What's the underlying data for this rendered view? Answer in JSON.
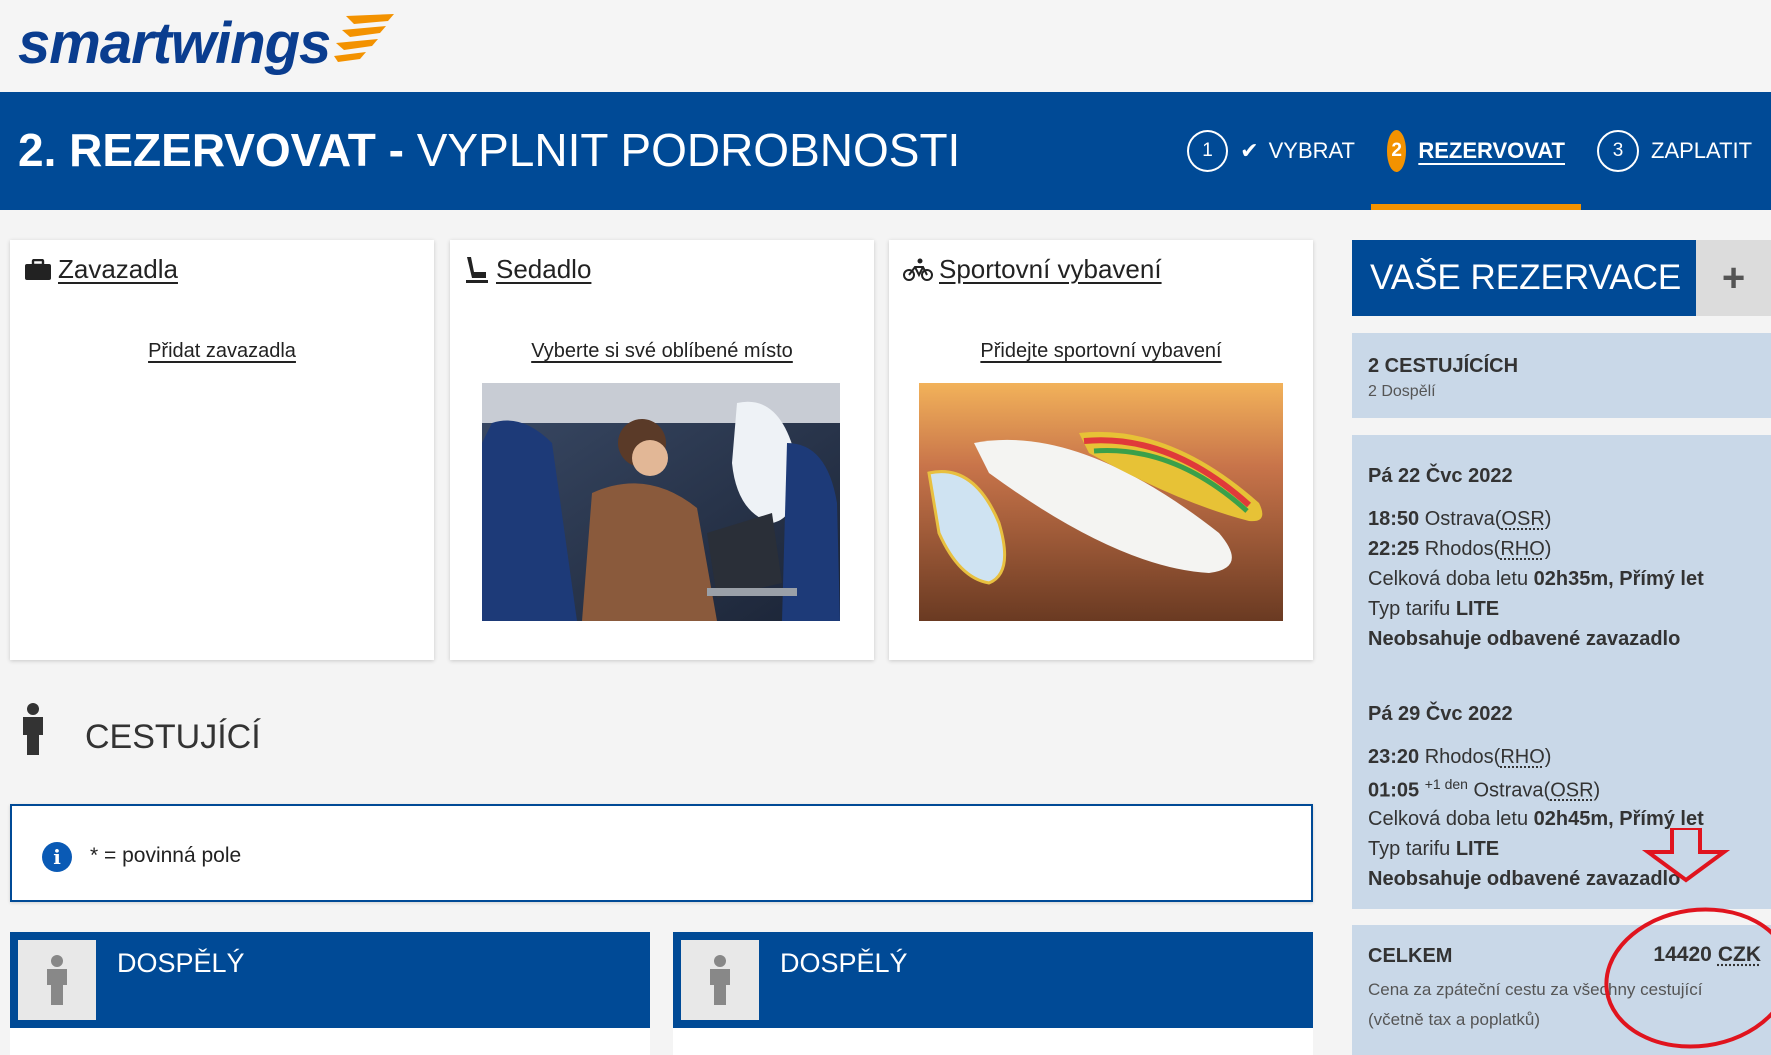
{
  "brand": {
    "logo_text": "smartwings",
    "accent": "#f39200",
    "primary": "#004a96"
  },
  "header": {
    "title_strong": "2. REZERVOVAT -",
    "title_light": " VYPLNIT PODROBNOSTI",
    "steps": [
      {
        "num": "1",
        "label": "VYBRAT",
        "state": "done"
      },
      {
        "num": "2",
        "label": "REZERVOVAT",
        "state": "active"
      },
      {
        "num": "3",
        "label": "ZAPLATIT",
        "state": "pending"
      }
    ]
  },
  "extras": [
    {
      "title": "Zavazadla",
      "link": "Přidat zavazadla",
      "icon": "suitcase-icon"
    },
    {
      "title": "Sedadlo",
      "link": "Vyberte si své oblíbené místo",
      "icon": "seat-icon"
    },
    {
      "title": "Sportovní vybavení",
      "link": "Přidejte sportovní vybavení",
      "icon": "bicycle-icon"
    }
  ],
  "travellers": {
    "title": "CESTUJÍCÍ",
    "required_note": "* = povinná pole",
    "passengers": [
      {
        "label": "DOSPĚLÝ"
      },
      {
        "label": "DOSPĚLÝ"
      }
    ]
  },
  "reservation": {
    "title": "VAŠE REZERVACE",
    "plus": "+",
    "pax_count": "2 CESTUJÍCÍCH",
    "pax_detail": "2 Dospělí",
    "outbound": {
      "date": "Pá 22 Čvc 2022",
      "dep_time": "18:50",
      "dep_city": "Ostrava",
      "dep_code": "OSR",
      "arr_time": "22:25",
      "arr_city": "Rhodos",
      "arr_code": "RHO",
      "duration_label": "Celková doba letu ",
      "duration": "02h35m, Přímý let",
      "fare_label": "Typ tarifu ",
      "fare": "LITE",
      "baggage": "Neobsahuje odbavené zavazadlo"
    },
    "inbound": {
      "date": "Pá 29 Čvc 2022",
      "dep_time": "23:20",
      "dep_city": "Rhodos",
      "dep_code": "RHO",
      "arr_time": "01:05",
      "arr_plus": "+1 den",
      "arr_city": "Ostrava",
      "arr_code": "OSR",
      "duration_label": "Celková doba letu ",
      "duration": "02h45m, Přímý let",
      "fare_label": "Typ tarifu ",
      "fare": "LITE",
      "baggage": "Neobsahuje odbavené zavazadlo"
    },
    "total_label": "CELKEM",
    "total_amount": "14420",
    "total_currency": "CZK",
    "total_note_1": "Cena za zpáteční cestu za všechny cestující",
    "total_note_2": "(včetně tax a poplatků)"
  }
}
